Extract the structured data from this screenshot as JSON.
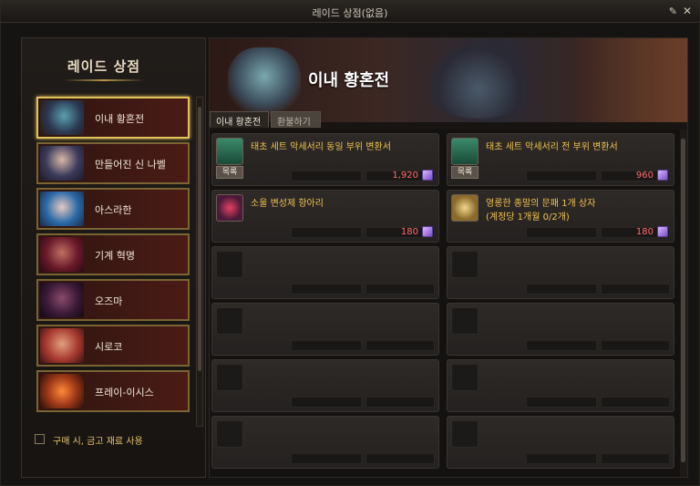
{
  "window": {
    "title": "레이드 상점(없음)"
  },
  "sidebar": {
    "title": "레이드 상점",
    "items": [
      {
        "label": "이내 황혼전",
        "active": true
      },
      {
        "label": "만들어진 신 나벨"
      },
      {
        "label": "아스라한"
      },
      {
        "label": "기계 혁명"
      },
      {
        "label": "오즈마"
      },
      {
        "label": "시로코"
      },
      {
        "label": "프레이-이시스"
      }
    ],
    "checkbox_label": "구매 시, 금고 재료 사용"
  },
  "main": {
    "banner_title": "이내 황혼전",
    "tabs": [
      {
        "label": "이내 황혼전"
      },
      {
        "label": "환불하기"
      }
    ],
    "cards": [
      {
        "name": "태초 세트 악세서리 동일 부위 변환서",
        "category": "목록",
        "price": "1,920"
      },
      {
        "name": "태초 세트 악세서리 전 부위 변환서",
        "category": "목록",
        "price": "960"
      },
      {
        "name": "소울 변성제 항아리",
        "price": "180"
      },
      {
        "name": "영롱한 종말의 문패 1개 상자",
        "name2": "(계정당 1개월 0/2개)",
        "price": "180"
      }
    ]
  },
  "colors": {
    "accent_gold": "#e2c25b",
    "price_red": "#ff6b6b",
    "name_yellow": "#f2c14e"
  }
}
